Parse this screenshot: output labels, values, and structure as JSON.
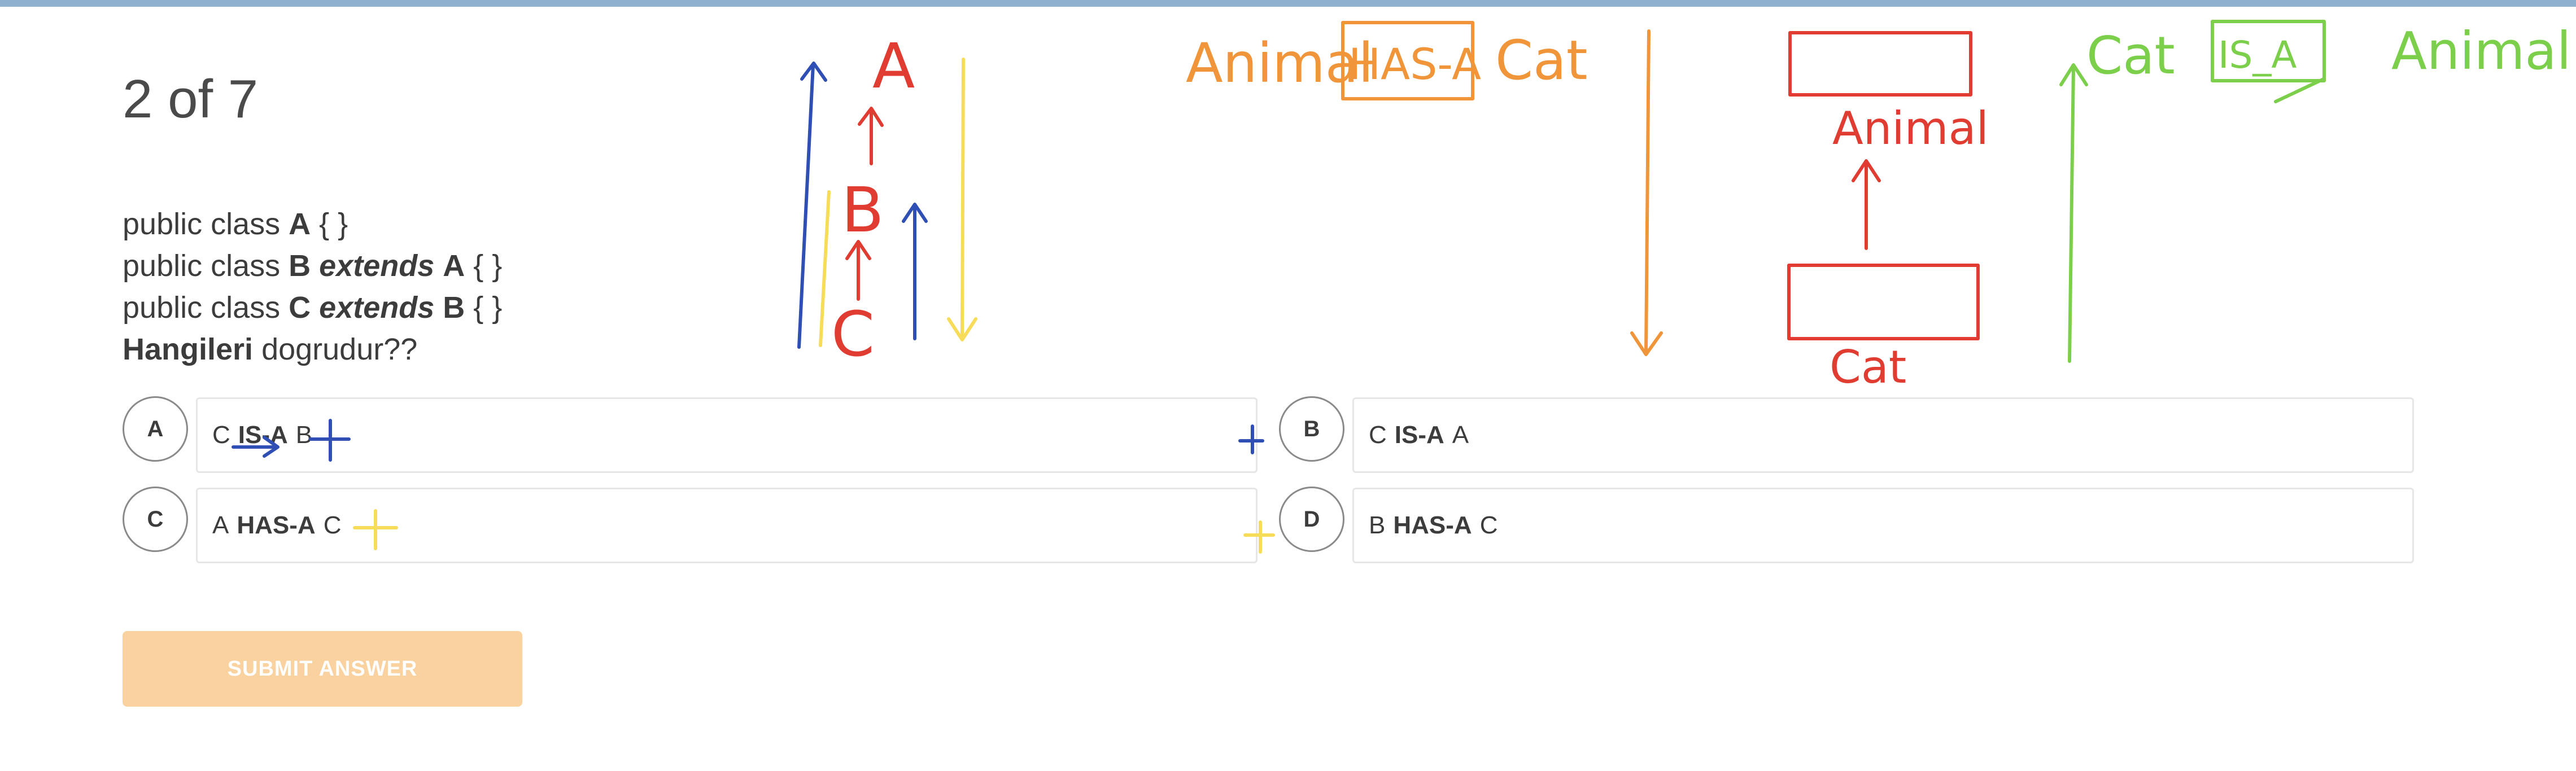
{
  "question": {
    "counter": "2 of 7",
    "line1": {
      "prefix": "public class ",
      "name": "A",
      "suffix": " { }"
    },
    "line2": {
      "prefix": "public class ",
      "name": "B",
      "keyword": "extends",
      "parent": "A",
      "suffix": " { }"
    },
    "line3": {
      "prefix": "public class ",
      "name": "C",
      "keyword": "extends",
      "parent": "B",
      "suffix": " { }"
    },
    "line4": {
      "bold": "Hangileri",
      "rest": " dogrudur??"
    }
  },
  "options": [
    {
      "letter": "A",
      "left": "C",
      "relation": "IS-A",
      "right": "B"
    },
    {
      "letter": "B",
      "left": "C",
      "relation": "IS-A",
      "right": "A"
    },
    {
      "letter": "C",
      "left": "A",
      "relation": "HAS-A",
      "right": "C"
    },
    {
      "letter": "D",
      "left": "B",
      "relation": "HAS-A",
      "right": "C"
    }
  ],
  "submit": {
    "label": "SUBMIT ANSWER"
  },
  "annotations": {
    "hierarchy": {
      "top": "A",
      "middle": "B",
      "bottom": "C"
    },
    "has_a_note": {
      "left": "Animal",
      "relation": "HAS-A",
      "right": "Cat"
    },
    "uml_note": {
      "top": "Animal",
      "bottom": "Cat"
    },
    "is_a_note": {
      "left": "Cat",
      "relation": "IS_A",
      "right": "Animal"
    },
    "colors": {
      "blue": "#2f4fb5",
      "red": "#e03c31",
      "yellow": "#f7dc5a",
      "orange": "#f0953a",
      "green": "#7ccf4a"
    }
  }
}
